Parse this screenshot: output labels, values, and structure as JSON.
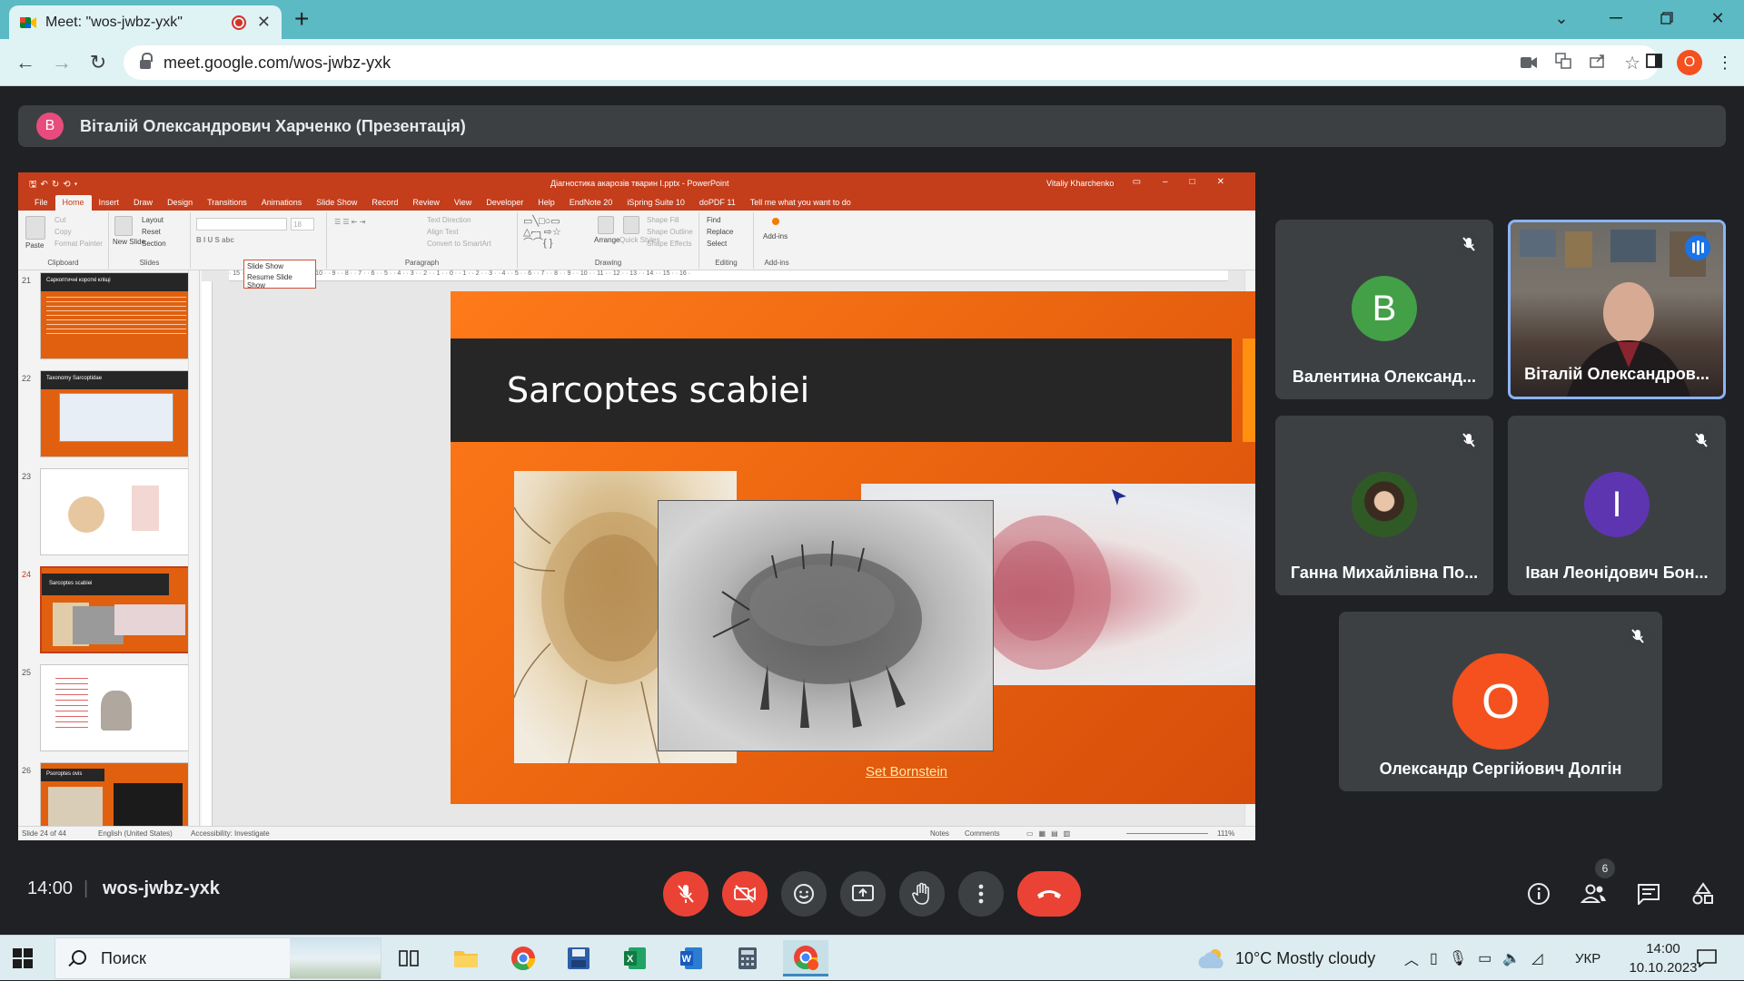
{
  "browser": {
    "tab_title": "Meet: \"wos-jwbz-yxk\"",
    "new_tab": "+",
    "url": "meet.google.com/wos-jwbz-yxk",
    "profile_initial": "O"
  },
  "meet": {
    "presenter_initial": "B",
    "presenter_label": "Віталій Олександрович Харченко (Презентація)",
    "time": "14:00",
    "meeting_code": "wos-jwbz-yxk",
    "participant_count": "6",
    "participants": [
      {
        "name": "Валентина Олександ...",
        "initial": "B",
        "color": "#43a047",
        "muted": true
      },
      {
        "name": "Віталій Олександров...",
        "initial": "",
        "speaking": true
      },
      {
        "name": "Ганна Михайлівна По...",
        "initial": "",
        "muted": true
      },
      {
        "name": "Іван Леонідович Бон...",
        "initial": "I",
        "color": "#5e35b1",
        "muted": true
      },
      {
        "name": "Олександр Сергійович Долгін",
        "initial": "O",
        "color": "#f4511e",
        "muted": true
      }
    ]
  },
  "powerpoint": {
    "doc_title": "Діагностика акарозів тварин I.pptx - PowerPoint",
    "user": "Vitaliy Kharchenko",
    "tabs": [
      "File",
      "Home",
      "Insert",
      "Draw",
      "Design",
      "Transitions",
      "Animations",
      "Slide Show",
      "Record",
      "Review",
      "View",
      "Developer",
      "Help",
      "EndNote 20",
      "iSpring Suite 10",
      "doPDF 11"
    ],
    "tell_me": "Tell me what you want to do",
    "ribbon": {
      "clipboard": {
        "paste": "Paste",
        "cut": "Cut",
        "copy": "Copy",
        "format_painter": "Format Painter",
        "label": "Clipboard"
      },
      "slides": {
        "new_slide": "New Slide",
        "layout": "Layout",
        "reset": "Reset",
        "section": "Section",
        "label": "Slides"
      },
      "paragraph": {
        "text_direction": "Text Direction",
        "align_text": "Align Text",
        "convert": "Convert to SmartArt",
        "label": "Paragraph"
      },
      "drawing": {
        "arrange": "Arrange",
        "quick_styles": "Quick Styles",
        "shape_fill": "Shape Fill",
        "shape_outline": "Shape Outline",
        "shape_effects": "Shape Effects",
        "label": "Drawing"
      },
      "editing": {
        "find": "Find",
        "replace": "Replace",
        "select": "Select",
        "label": "Editing"
      },
      "addins": {
        "addins": "Add-ins",
        "label": "Add-ins"
      },
      "font_size": "18"
    },
    "slideshow_popup": {
      "title": "Slide Show",
      "resume": "Resume Slide Show"
    },
    "thumbnails": [
      {
        "num": "21",
        "title": "Саркоптичні короткі кліщі"
      },
      {
        "num": "22",
        "title": "Taxonomy Sarcoptidae"
      },
      {
        "num": "23",
        "title": ""
      },
      {
        "num": "24",
        "title": "Sarcoptes scabiei"
      },
      {
        "num": "25",
        "title": ""
      },
      {
        "num": "26",
        "title": "Psoroptes ovis"
      }
    ],
    "ruler_ticks": "· 15 · · 14 · · 13 · · 12 · · 11 · · 10 · · 9 · · 8 · · 7 · · 6 · · 5 · · 4 · · 3 · · 2 · · 1 · · 0 · · 1 · · 2 · · 3 · · 4 · · 5 · · 6 · · 7 · · 8 · · 9 · · 10 · · 11 · · 12 · · 13 · · 14 · · 15 · · 16 ·",
    "slide": {
      "title": "Sarcoptes scabiei",
      "caption": "Set Bornstein"
    },
    "status": {
      "slide_of": "Slide 24 of 44",
      "language": "English (United States)",
      "accessibility": "Accessibility: Investigate",
      "notes": "Notes",
      "comments": "Comments",
      "zoom": "111%"
    }
  },
  "taskbar": {
    "search_placeholder": "Поиск",
    "weather": "10°C  Mostly cloudy",
    "language": "УКР",
    "time": "14:00",
    "date": "10.10.2023"
  },
  "colors": {
    "meet_bg": "#202124",
    "tile_bg": "#3c4043",
    "ppt_red": "#c43e1c",
    "slide_orange": "#f06a12",
    "end_call": "#ea4335",
    "active_border": "#8ab4f8"
  }
}
